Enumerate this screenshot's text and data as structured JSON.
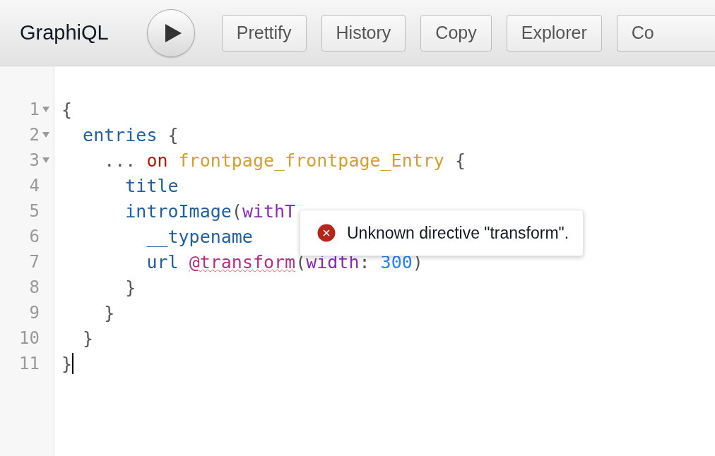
{
  "toolbar": {
    "title": "GraphiQL",
    "buttons": [
      {
        "label": "Prettify"
      },
      {
        "label": "History"
      },
      {
        "label": "Copy"
      },
      {
        "label": "Explorer"
      },
      {
        "label": "Co",
        "cut": true
      }
    ]
  },
  "editor": {
    "lines": [
      {
        "number": "1",
        "foldable": true,
        "tokens": [
          {
            "kind": "punct",
            "text": "{"
          }
        ]
      },
      {
        "number": "2",
        "foldable": true,
        "tokens": [
          {
            "kind": "property",
            "text": "  entries"
          },
          {
            "kind": "punct",
            "text": " {"
          }
        ]
      },
      {
        "number": "3",
        "foldable": true,
        "tokens": [
          {
            "kind": "punct",
            "text": "    ..."
          },
          {
            "kind": "keyword",
            "text": " on"
          },
          {
            "kind": "def",
            "text": " frontpage_frontpage_Entry"
          },
          {
            "kind": "punct",
            "text": " {"
          }
        ]
      },
      {
        "number": "4",
        "foldable": false,
        "tokens": [
          {
            "kind": "property",
            "text": "      title"
          }
        ]
      },
      {
        "number": "5",
        "foldable": false,
        "tokens": [
          {
            "kind": "property",
            "text": "      introImage"
          },
          {
            "kind": "punct",
            "text": "("
          },
          {
            "kind": "attribute",
            "text": "withT"
          }
        ]
      },
      {
        "number": "6",
        "foldable": false,
        "tokens": [
          {
            "kind": "property",
            "text": "        __typename"
          }
        ]
      },
      {
        "number": "7",
        "foldable": false,
        "tokens": [
          {
            "kind": "property",
            "text": "        url "
          },
          {
            "kind": "directive",
            "text": "@transform",
            "error": true
          },
          {
            "kind": "punct",
            "text": "("
          },
          {
            "kind": "attribute",
            "text": "width"
          },
          {
            "kind": "punct",
            "text": ": "
          },
          {
            "kind": "number",
            "text": "300"
          },
          {
            "kind": "punct",
            "text": ")"
          }
        ]
      },
      {
        "number": "8",
        "foldable": false,
        "tokens": [
          {
            "kind": "punct",
            "text": "      }"
          }
        ]
      },
      {
        "number": "9",
        "foldable": false,
        "tokens": [
          {
            "kind": "punct",
            "text": "    }"
          }
        ]
      },
      {
        "number": "10",
        "foldable": false,
        "tokens": [
          {
            "kind": "punct",
            "text": "  }"
          }
        ]
      },
      {
        "number": "11",
        "foldable": false,
        "cursor": true,
        "tokens": [
          {
            "kind": "punct",
            "text": "}"
          }
        ]
      }
    ],
    "error_tooltip": {
      "message": "Unknown directive \"transform\"."
    }
  }
}
